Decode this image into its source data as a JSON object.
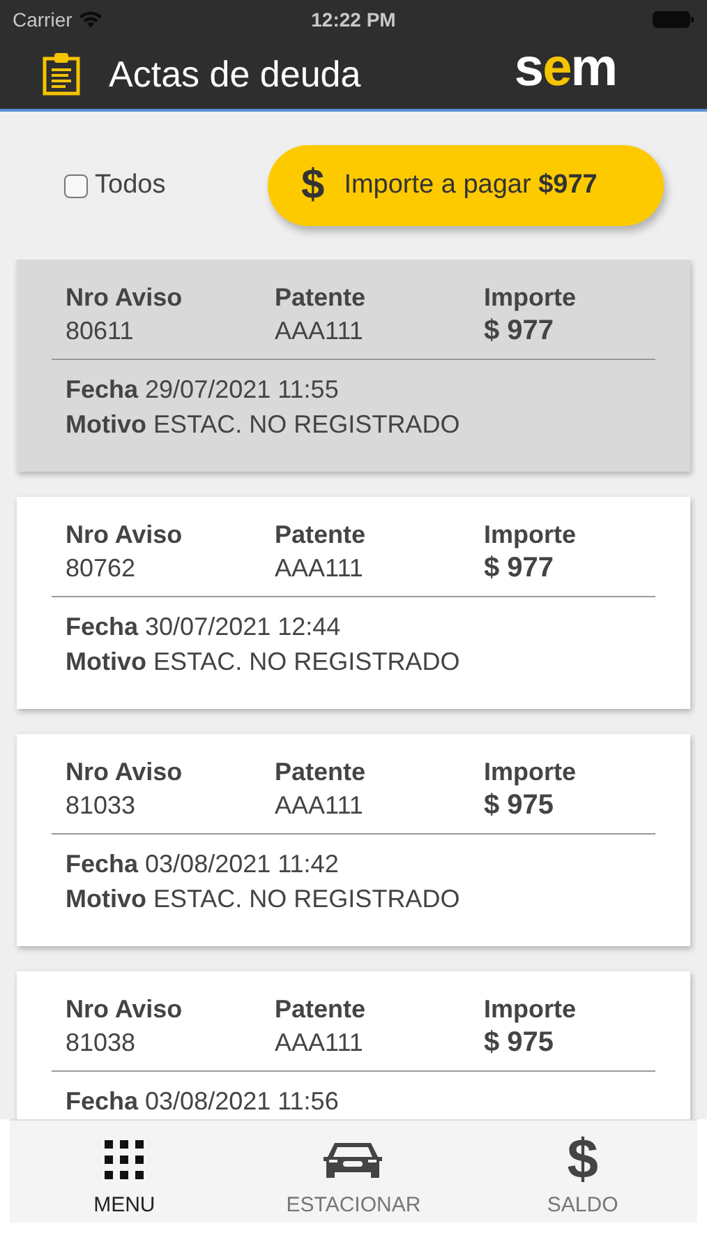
{
  "status_bar": {
    "carrier": "Carrier",
    "time": "12:22 PM"
  },
  "header": {
    "title": "Actas de deuda",
    "logo": "sem"
  },
  "select_all": {
    "label": "Todos",
    "checked": false
  },
  "pay_button": {
    "label": "Importe a pagar **$977**",
    "icon": "$"
  },
  "cards": [
    {
      "selected": true,
      "labels": [
        "Nro Aviso",
        "Patente",
        "Importe"
      ],
      "aviso": "80611",
      "patente": "AAA111",
      "importe": "$ 977",
      "fecha_label": "Fecha",
      "fecha": "29/07/2021 11:55",
      "motivo_label": "Motivo",
      "motivo": "ESTAC. NO REGISTRADO"
    },
    {
      "selected": false,
      "labels": [
        "Nro Aviso",
        "Patente",
        "Importe"
      ],
      "aviso": "80762",
      "patente": "AAA111",
      "importe": "$ 977",
      "fecha_label": "Fecha",
      "fecha": "30/07/2021 12:44",
      "motivo_label": "Motivo",
      "motivo": "ESTAC. NO REGISTRADO"
    },
    {
      "selected": false,
      "labels": [
        "Nro Aviso",
        "Patente",
        "Importe"
      ],
      "aviso": "81033",
      "patente": "AAA111",
      "importe": "$ 975",
      "fecha_label": "Fecha",
      "fecha": "03/08/2021 11:42",
      "motivo_label": "Motivo",
      "motivo": "ESTAC. NO REGISTRADO"
    },
    {
      "selected": false,
      "labels": [
        "Nro Aviso",
        "Patente",
        "Importe"
      ],
      "aviso": "81038",
      "patente": "AAA111",
      "importe": "$ 975",
      "fecha_label": "Fecha",
      "fecha": "03/08/2021 11:56"
    }
  ],
  "tab_bar": [
    {
      "kind": "menu",
      "label": "MENU",
      "selected": true
    },
    {
      "kind": "car",
      "label": "ESTACIONAR",
      "selected": false
    },
    {
      "kind": "dollar",
      "label": "SALDO",
      "selected": false,
      "icon": "$"
    }
  ]
}
